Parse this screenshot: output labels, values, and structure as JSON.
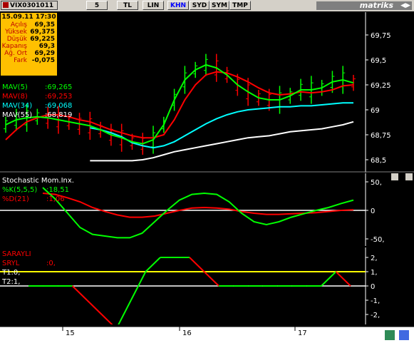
{
  "toolbar": {
    "symbol": "VIX0301011",
    "buttons": [
      "5",
      "TL",
      "LIN",
      "KHN",
      "SYD",
      "SYM",
      "TMP"
    ],
    "active": "KHN",
    "brand": "matriks"
  },
  "info": {
    "date": "15.09.11 17:30",
    "rows": [
      {
        "label": "Açılış",
        "value": "69,35"
      },
      {
        "label": "Yüksek",
        "value": "69,375"
      },
      {
        "label": "Düşük",
        "value": "69,225"
      },
      {
        "label": "Kapanış",
        "value": "69,3"
      },
      {
        "label": "Ağ. Ort",
        "value": "69,29"
      },
      {
        "label": "Fark",
        "value": "-0,075"
      }
    ]
  },
  "price_legend": [
    {
      "label": "MAV(5)",
      "value": ":69,265",
      "color": "#00ff00"
    },
    {
      "label": "MAV(8)",
      "value": ":69,253",
      "color": "#ff0000"
    },
    {
      "label": "MAV(34)",
      "value": ":69,068",
      "color": "#00ffff"
    },
    {
      "label": "MAV(55)",
      "value": ":68,819",
      "color": "#ffffff"
    }
  ],
  "stoch_legend": [
    {
      "label": "Stochastic Mom.Inx.",
      "value": "",
      "color": "#ffffff"
    },
    {
      "label": "%K(5,5,5)",
      "value": ":18,51",
      "color": "#00ff00"
    },
    {
      "label": "%D(21)",
      "value": ":1,06",
      "color": "#ff0000"
    }
  ],
  "sar_legend": [
    {
      "label": "SARAYLI",
      "value": "",
      "color": "#ff0000"
    },
    {
      "label": "SRYL",
      "value": ":0,",
      "color": "#ff0000"
    },
    {
      "label": "T1:0,",
      "value": "",
      "color": "#ffffff"
    },
    {
      "label": "T2:1,",
      "value": "",
      "color": "#ffffff"
    }
  ],
  "price_axis": [
    "69,75",
    "69,5",
    "69,25",
    "69",
    "68,75",
    "68,5"
  ],
  "stoch_axis": [
    "50,",
    "0",
    "-50,"
  ],
  "sar_axis": [
    "2,",
    "1,",
    "0",
    "-1,",
    "-2,"
  ],
  "date_axis": [
    "15",
    "16",
    "17"
  ],
  "chart_data": {
    "type": "bar",
    "price_range": [
      68.4,
      69.95
    ],
    "ma5": [
      68.85,
      68.9,
      68.92,
      68.93,
      68.92,
      68.9,
      68.88,
      68.86,
      68.84,
      68.8,
      68.75,
      68.72,
      68.68,
      68.66,
      68.7,
      68.85,
      69.1,
      69.3,
      69.4,
      69.45,
      69.42,
      69.35,
      69.25,
      69.18,
      69.12,
      69.1,
      69.1,
      69.14,
      69.2,
      69.2,
      69.22,
      69.28,
      69.3,
      69.27
    ],
    "ma8": [
      68.7,
      68.8,
      68.88,
      68.92,
      68.95,
      68.95,
      68.93,
      68.9,
      68.88,
      68.84,
      68.8,
      68.77,
      68.74,
      68.72,
      68.72,
      68.75,
      68.9,
      69.1,
      69.25,
      69.35,
      69.38,
      69.37,
      69.33,
      69.28,
      69.22,
      69.17,
      69.15,
      69.16,
      69.18,
      69.17,
      69.18,
      69.2,
      69.24,
      69.25
    ],
    "ma34": [
      null,
      null,
      null,
      null,
      null,
      null,
      null,
      null,
      68.82,
      68.8,
      68.77,
      68.73,
      68.67,
      68.64,
      68.62,
      68.64,
      68.68,
      68.74,
      68.8,
      68.86,
      68.91,
      68.95,
      68.98,
      69.0,
      69.01,
      69.02,
      69.03,
      69.03,
      69.04,
      69.04,
      69.05,
      69.06,
      69.07,
      69.07
    ],
    "ma55": [
      null,
      null,
      null,
      null,
      null,
      null,
      null,
      null,
      68.49,
      68.49,
      68.49,
      68.49,
      68.49,
      68.5,
      68.52,
      68.55,
      68.58,
      68.6,
      68.62,
      68.64,
      68.66,
      68.68,
      68.7,
      68.72,
      68.73,
      68.74,
      68.76,
      68.78,
      68.79,
      68.8,
      68.81,
      68.83,
      68.85,
      68.88
    ],
    "stoch_k": [
      40,
      20,
      -5,
      -30,
      -42,
      -45,
      -48,
      -48,
      -40,
      -20,
      0,
      18,
      28,
      30,
      28,
      15,
      -5,
      -20,
      -25,
      -20,
      -12,
      -6,
      0,
      5,
      12,
      18
    ],
    "stoch_d": [
      30,
      28,
      22,
      15,
      5,
      -2,
      -8,
      -12,
      -12,
      -10,
      -5,
      0,
      4,
      5,
      4,
      2,
      -2,
      -5,
      -7,
      -7,
      -6,
      -5,
      -4,
      -2,
      0,
      1
    ],
    "sryl": [
      0,
      0,
      0,
      0,
      -1,
      -2,
      -3,
      -1,
      1,
      2,
      2,
      2,
      1,
      0,
      0,
      0,
      0,
      0,
      0,
      0,
      0,
      1,
      0
    ],
    "t1": 0,
    "t2": 1
  }
}
